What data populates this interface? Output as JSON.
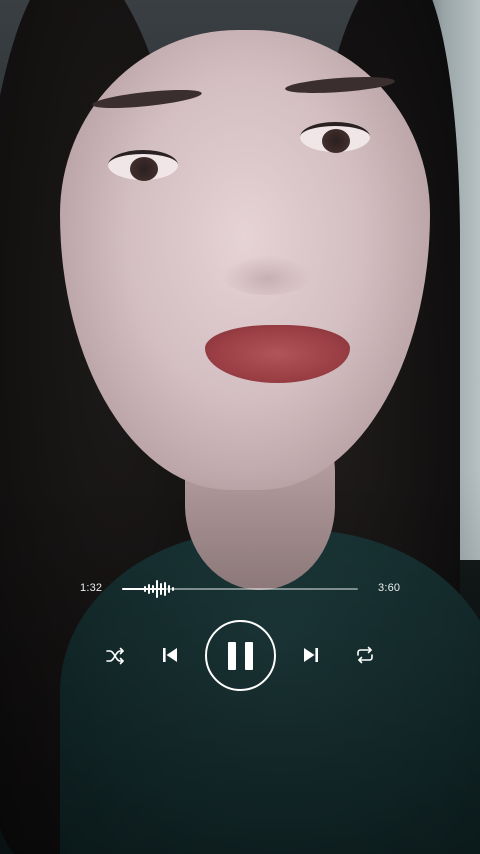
{
  "player": {
    "elapsed_time": "1:32",
    "total_time": "3:60",
    "progress": 0.18,
    "state": "playing",
    "controls": {
      "shuffle_icon": "shuffle-icon",
      "previous_icon": "skip-previous-icon",
      "play_pause_icon": "pause-icon",
      "next_icon": "skip-next-icon",
      "repeat_icon": "repeat-icon"
    }
  },
  "colors": {
    "control": "#ffffff",
    "track": "rgba(255,255,255,0.45)"
  }
}
